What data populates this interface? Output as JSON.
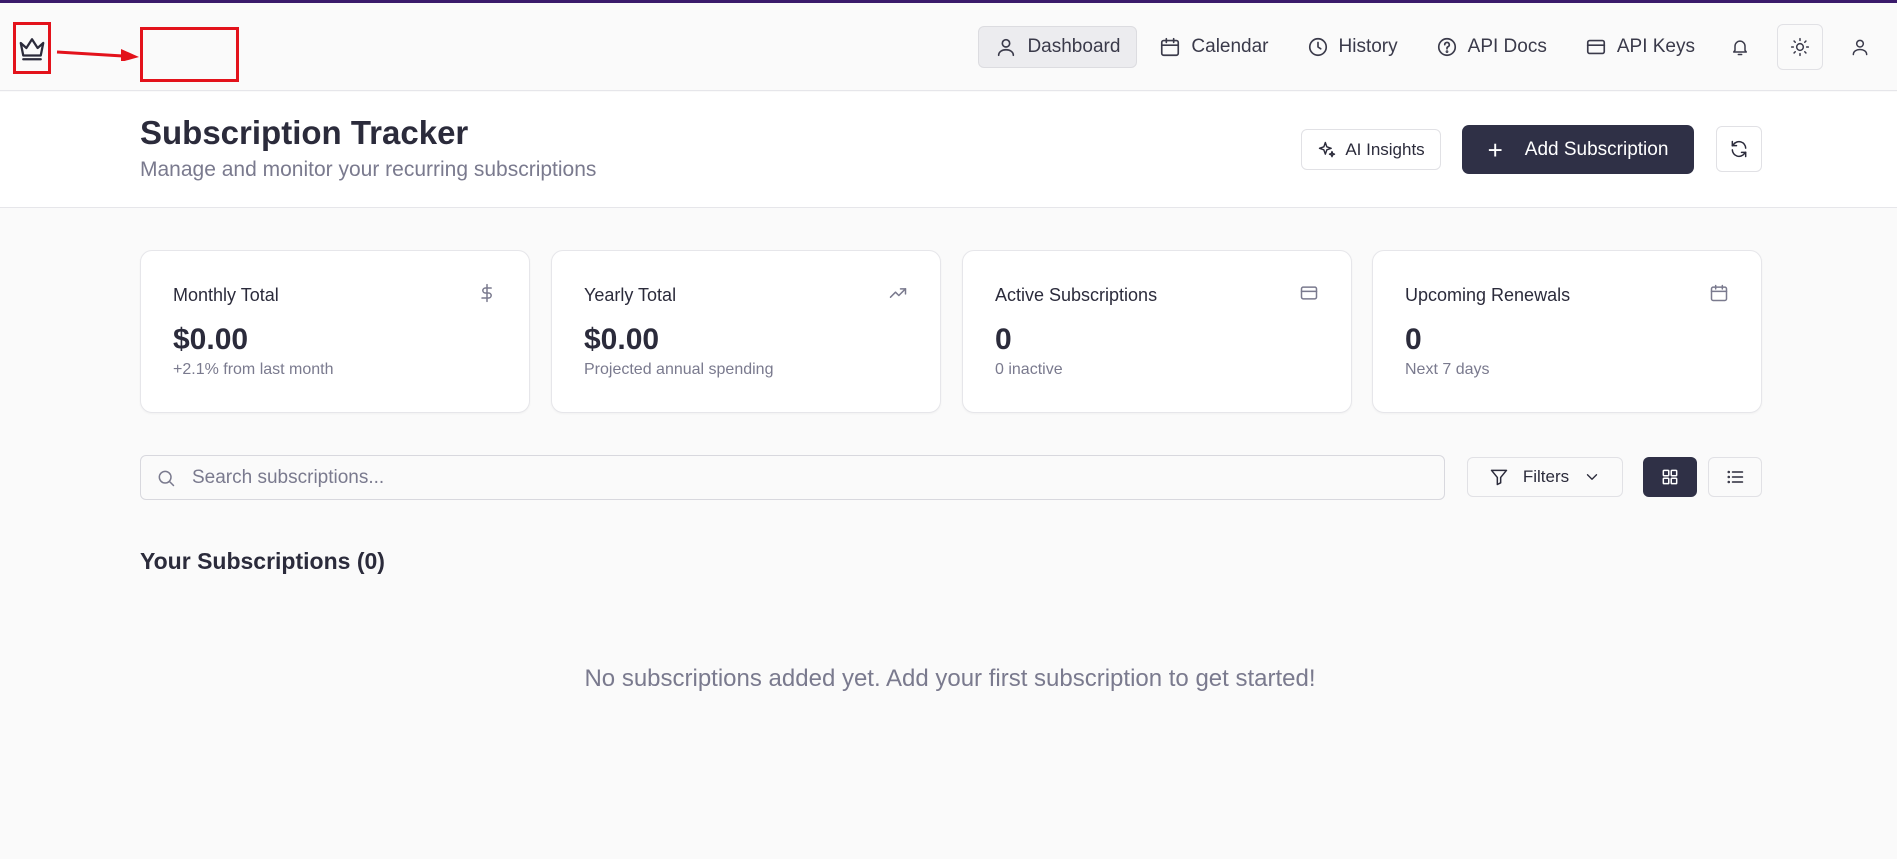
{
  "nav": {
    "items": [
      {
        "label": "Dashboard",
        "icon": "user-icon",
        "active": true
      },
      {
        "label": "Calendar",
        "icon": "calendar-icon",
        "active": false
      },
      {
        "label": "History",
        "icon": "clock-icon",
        "active": false
      },
      {
        "label": "API Docs",
        "icon": "help-circle-icon",
        "active": false
      },
      {
        "label": "API Keys",
        "icon": "credit-card-icon",
        "active": false
      }
    ],
    "logo_icon": "crown-icon",
    "annotation_color": "#e3121b"
  },
  "header": {
    "title": "Subscription Tracker",
    "subtitle": "Manage and monitor your recurring subscriptions",
    "ai_label": "AI Insights",
    "add_label": "Add Subscription"
  },
  "stats": [
    {
      "title": "Monthly Total",
      "value": "$0.00",
      "sub": "+2.1% from last month",
      "icon": "dollar-icon"
    },
    {
      "title": "Yearly Total",
      "value": "$0.00",
      "sub": "Projected annual spending",
      "icon": "trending-up-icon"
    },
    {
      "title": "Active Subscriptions",
      "value": "0",
      "sub": "0 inactive",
      "icon": "credit-card-icon"
    },
    {
      "title": "Upcoming Renewals",
      "value": "0",
      "sub": "Next 7 days",
      "icon": "calendar-icon"
    }
  ],
  "toolbar": {
    "search_placeholder": "Search subscriptions...",
    "filters_label": "Filters",
    "view_mode": "grid"
  },
  "list": {
    "title": "Your Subscriptions (0)",
    "empty_message": "No subscriptions added yet. Add your first subscription to get started!"
  },
  "colors": {
    "primary": "#2f3046",
    "muted_text": "#7a7a8e",
    "top_accent": "#3a1a6b"
  }
}
